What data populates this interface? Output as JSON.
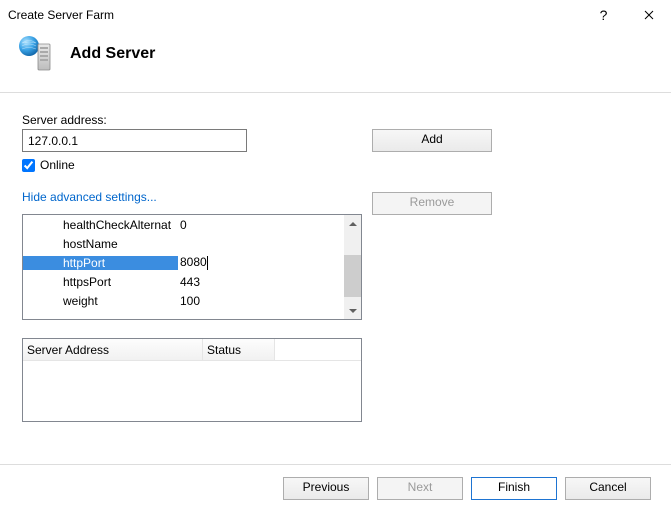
{
  "window": {
    "title": "Create Server Farm",
    "heading": "Add Server"
  },
  "fields": {
    "server_address_label": "Server address:",
    "server_address_value": "127.0.0.1",
    "online_label": "Online",
    "online_checked": true,
    "advanced_link": "Hide advanced settings..."
  },
  "buttons": {
    "add": "Add",
    "remove": "Remove",
    "previous": "Previous",
    "next": "Next",
    "finish": "Finish",
    "cancel": "Cancel"
  },
  "grid": {
    "rows": [
      {
        "name": "healthCheckAlternat",
        "value": "0",
        "selected": false,
        "editing": false
      },
      {
        "name": "hostName",
        "value": "",
        "selected": false,
        "editing": false
      },
      {
        "name": "httpPort",
        "value": "8080",
        "selected": true,
        "editing": true
      },
      {
        "name": "httpsPort",
        "value": "443",
        "selected": false,
        "editing": false
      },
      {
        "name": "weight",
        "value": "100",
        "selected": false,
        "editing": false
      }
    ]
  },
  "serverlist": {
    "columns": [
      "Server Address",
      "Status"
    ]
  },
  "icons": {
    "help": "?",
    "close": "close-icon"
  }
}
